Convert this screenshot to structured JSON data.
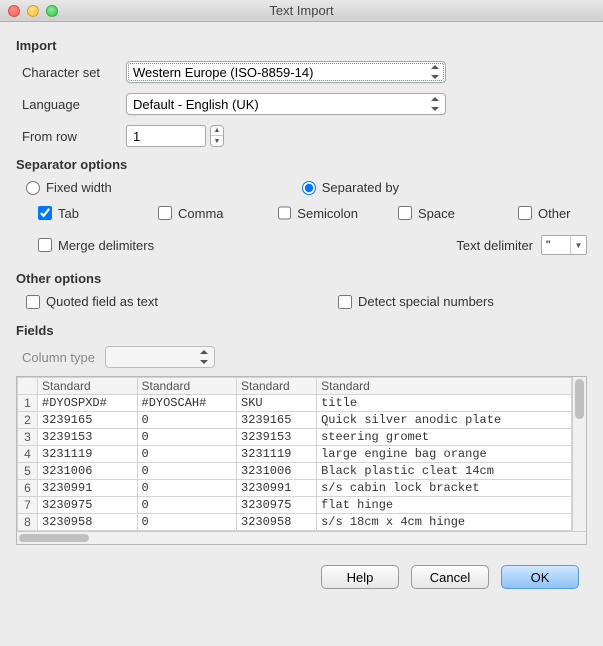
{
  "window": {
    "title": "Text Import"
  },
  "import": {
    "section": "Import",
    "charset_label": "Character set",
    "charset_value": "Western Europe (ISO-8859-14)",
    "language_label": "Language",
    "language_value": "Default - English (UK)",
    "fromrow_label": "From row",
    "fromrow_value": "1"
  },
  "separator": {
    "section": "Separator options",
    "fixed": "Fixed width",
    "separated": "Separated by",
    "tab": "Tab",
    "comma": "Comma",
    "semicolon": "Semicolon",
    "space": "Space",
    "other": "Other",
    "other_value": "",
    "merge": "Merge delimiters",
    "text_delim_label": "Text delimiter",
    "text_delim_value": "\""
  },
  "other": {
    "section": "Other options",
    "quoted": "Quoted field as text",
    "detect": "Detect special numbers"
  },
  "fields": {
    "section": "Fields",
    "coltype_label": "Column type",
    "headers": [
      "Standard",
      "Standard",
      "Standard",
      "Standard"
    ],
    "rows": [
      [
        "#DYOSPXD#",
        "#DYOSCAH#",
        "SKU",
        "title"
      ],
      [
        "3239165",
        "0",
        "3239165",
        "Quick silver anodic plate"
      ],
      [
        "3239153",
        "0",
        "3239153",
        "steering gromet"
      ],
      [
        "3231119",
        "0",
        "3231119",
        "large engine bag orange"
      ],
      [
        "3231006",
        "0",
        "3231006",
        "Black plastic cleat 14cm"
      ],
      [
        "3230991",
        "0",
        "3230991",
        "s/s cabin lock  bracket"
      ],
      [
        "3230975",
        "0",
        "3230975",
        "flat hinge"
      ],
      [
        "3230958",
        "0",
        "3230958",
        "s/s 18cm x 4cm hinge"
      ]
    ]
  },
  "buttons": {
    "help": "Help",
    "cancel": "Cancel",
    "ok": "OK"
  }
}
